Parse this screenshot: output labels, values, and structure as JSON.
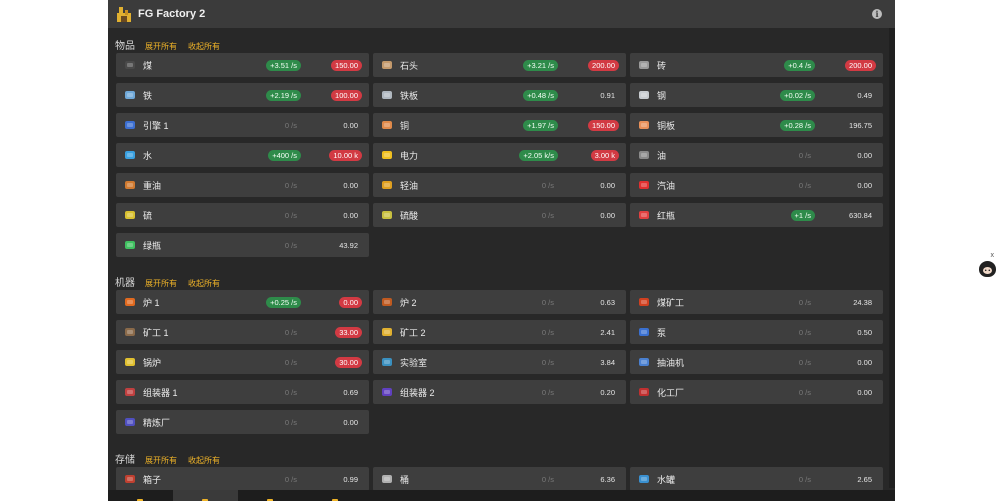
{
  "app": {
    "title": "FG Factory 2"
  },
  "sections": [
    {
      "title": "物品",
      "expand_all": "展开所有",
      "collapse_all": "收起所有",
      "items": [
        {
          "name": "煤",
          "rate": "+3.51 /s",
          "rate_pos": true,
          "count": "150.00",
          "count_warn": true,
          "icon": "coal-icon",
          "color": "#4a4a4a"
        },
        {
          "name": "石头",
          "rate": "+3.21 /s",
          "rate_pos": true,
          "count": "200.00",
          "count_warn": true,
          "icon": "stone-icon",
          "color": "#c49a6c"
        },
        {
          "name": "砖",
          "rate": "+0.4 /s",
          "rate_pos": true,
          "count": "200.00",
          "count_warn": true,
          "icon": "brick-icon",
          "color": "#9a9a9a"
        },
        {
          "name": "铁",
          "rate": "+2.19 /s",
          "rate_pos": true,
          "count": "100.00",
          "count_warn": true,
          "icon": "iron-ore-icon",
          "color": "#6fa8d8"
        },
        {
          "name": "铁板",
          "rate": "+0.48 /s",
          "rate_pos": true,
          "count": "0.91",
          "count_warn": false,
          "icon": "iron-plate-icon",
          "color": "#b0b8c0"
        },
        {
          "name": "钢",
          "rate": "+0.02 /s",
          "rate_pos": true,
          "count": "0.49",
          "count_warn": false,
          "icon": "steel-icon",
          "color": "#c8ccd0"
        },
        {
          "name": "引擎 1",
          "rate": "0 /s",
          "rate_pos": false,
          "count": "0.00",
          "count_warn": false,
          "icon": "engine-icon",
          "color": "#3c6fd1"
        },
        {
          "name": "铜",
          "rate": "+1.97 /s",
          "rate_pos": true,
          "count": "150.00",
          "count_warn": true,
          "icon": "copper-ore-icon",
          "color": "#e08a4a"
        },
        {
          "name": "铜板",
          "rate": "+0.28 /s",
          "rate_pos": true,
          "count": "196.75",
          "count_warn": false,
          "icon": "copper-plate-icon",
          "color": "#e8905a"
        },
        {
          "name": "水",
          "rate": "+400 /s",
          "rate_pos": true,
          "count": "10.00 k",
          "count_warn": true,
          "icon": "water-icon",
          "color": "#3aa0e0"
        },
        {
          "name": "电力",
          "rate": "+2.05 k/s",
          "rate_pos": true,
          "count": "3.00 k",
          "count_warn": true,
          "icon": "electricity-icon",
          "color": "#f0c020"
        },
        {
          "name": "油",
          "rate": "0 /s",
          "rate_pos": false,
          "count": "0.00",
          "count_warn": false,
          "icon": "oil-icon",
          "color": "#8a8a8a"
        },
        {
          "name": "重油",
          "rate": "0 /s",
          "rate_pos": false,
          "count": "0.00",
          "count_warn": false,
          "icon": "heavy-oil-icon",
          "color": "#d07a30"
        },
        {
          "name": "轻油",
          "rate": "0 /s",
          "rate_pos": false,
          "count": "0.00",
          "count_warn": false,
          "icon": "light-oil-icon",
          "color": "#e0a020"
        },
        {
          "name": "汽油",
          "rate": "0 /s",
          "rate_pos": false,
          "count": "0.00",
          "count_warn": false,
          "icon": "gasoline-icon",
          "color": "#e03030"
        },
        {
          "name": "硫",
          "rate": "0 /s",
          "rate_pos": false,
          "count": "0.00",
          "count_warn": false,
          "icon": "sulfur-icon",
          "color": "#d8c030"
        },
        {
          "name": "硫酸",
          "rate": "0 /s",
          "rate_pos": false,
          "count": "0.00",
          "count_warn": false,
          "icon": "sulfuric-acid-icon",
          "color": "#c8c040"
        },
        {
          "name": "红瓶",
          "rate": "+1 /s",
          "rate_pos": true,
          "count": "630.84",
          "count_warn": false,
          "icon": "red-flask-icon",
          "color": "#e04040"
        },
        {
          "name": "绿瓶",
          "rate": "0 /s",
          "rate_pos": false,
          "count": "43.92",
          "count_warn": false,
          "icon": "green-flask-icon",
          "color": "#40c060"
        }
      ]
    },
    {
      "title": "机器",
      "expand_all": "展开所有",
      "collapse_all": "收起所有",
      "items": [
        {
          "name": "炉 1",
          "rate": "+0.25 /s",
          "rate_pos": true,
          "count": "0.00",
          "count_warn": true,
          "icon": "furnace-icon",
          "color": "#e06a20"
        },
        {
          "name": "炉 2",
          "rate": "0 /s",
          "rate_pos": false,
          "count": "0.63",
          "count_warn": false,
          "icon": "furnace-2-icon",
          "color": "#c05a20"
        },
        {
          "name": "煤矿工",
          "rate": "0 /s",
          "rate_pos": false,
          "count": "24.38",
          "count_warn": false,
          "icon": "coal-miner-icon",
          "color": "#d04020"
        },
        {
          "name": "矿工 1",
          "rate": "0 /s",
          "rate_pos": false,
          "count": "33.00",
          "count_warn": true,
          "icon": "miner-icon",
          "color": "#8a6a4a"
        },
        {
          "name": "矿工 2",
          "rate": "0 /s",
          "rate_pos": false,
          "count": "2.41",
          "count_warn": false,
          "icon": "miner-2-icon",
          "color": "#e0b030"
        },
        {
          "name": "泵",
          "rate": "0 /s",
          "rate_pos": false,
          "count": "0.50",
          "count_warn": false,
          "icon": "pump-icon",
          "color": "#3a70d0"
        },
        {
          "name": "锅炉",
          "rate": "0 /s",
          "rate_pos": false,
          "count": "30.00",
          "count_warn": true,
          "icon": "boiler-icon",
          "color": "#e0c030"
        },
        {
          "name": "实验室",
          "rate": "0 /s",
          "rate_pos": false,
          "count": "3.84",
          "count_warn": false,
          "icon": "lab-icon",
          "color": "#3a90c0"
        },
        {
          "name": "抽油机",
          "rate": "0 /s",
          "rate_pos": false,
          "count": "0.00",
          "count_warn": false,
          "icon": "pumpjack-icon",
          "color": "#4a80d0"
        },
        {
          "name": "组装器 1",
          "rate": "0 /s",
          "rate_pos": false,
          "count": "0.69",
          "count_warn": false,
          "icon": "assembler-icon",
          "color": "#c04040"
        },
        {
          "name": "组装器 2",
          "rate": "0 /s",
          "rate_pos": false,
          "count": "0.20",
          "count_warn": false,
          "icon": "assembler-2-icon",
          "color": "#6040c0"
        },
        {
          "name": "化工厂",
          "rate": "0 /s",
          "rate_pos": false,
          "count": "0.00",
          "count_warn": false,
          "icon": "chemical-plant-icon",
          "color": "#c03030"
        },
        {
          "name": "精炼厂",
          "rate": "0 /s",
          "rate_pos": false,
          "count": "0.00",
          "count_warn": false,
          "icon": "refinery-icon",
          "color": "#5050c0"
        }
      ]
    },
    {
      "title": "存储",
      "expand_all": "展开所有",
      "collapse_all": "收起所有",
      "items": [
        {
          "name": "箱子",
          "rate": "0 /s",
          "rate_pos": false,
          "count": "0.99",
          "count_warn": false,
          "icon": "chest-icon",
          "color": "#c04030"
        },
        {
          "name": "桶",
          "rate": "0 /s",
          "rate_pos": false,
          "count": "6.36",
          "count_warn": false,
          "icon": "barrel-icon",
          "color": "#b0b0b0"
        },
        {
          "name": "水罐",
          "rate": "0 /s",
          "rate_pos": false,
          "count": "2.65",
          "count_warn": false,
          "icon": "water-tank-icon",
          "color": "#3a90d0"
        }
      ]
    }
  ],
  "bottom_tabs": [
    {
      "name": "tab-resources",
      "icon": "bulb-icon",
      "active": false
    },
    {
      "name": "tab-factory",
      "icon": "factory-icon",
      "active": true
    },
    {
      "name": "tab-grid",
      "icon": "grid-icon",
      "active": false
    },
    {
      "name": "tab-settings",
      "icon": "gear-icon",
      "active": false
    }
  ],
  "colors": {
    "accent": "#f0b428",
    "positive": "#2e8b4a",
    "warning": "#d23a43",
    "card": "#3e3e3e",
    "background": "#282828"
  }
}
